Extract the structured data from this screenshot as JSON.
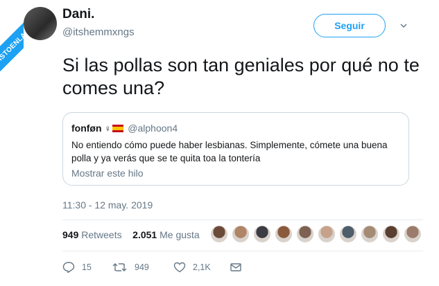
{
  "watermark": {
    "text": "VISTOENLASREDES.COM"
  },
  "author": {
    "name": "Dani.",
    "handle": "@itshemmxngs"
  },
  "follow_button": {
    "label": "Seguir"
  },
  "tweet": {
    "text": "Si las pollas son tan geniales por qué no te comes una?"
  },
  "quoted": {
    "name": "fonføn",
    "symbol": "♀",
    "handle": "@alphoon4",
    "text": "No entiendo cómo puede haber lesbianas. Simplemente, cómete una buena polla y ya verás que se te quita toa la tontería",
    "thread_link": "Mostrar este hilo"
  },
  "timestamp": "11:30 - 12 may. 2019",
  "stats": {
    "retweets_count": "949",
    "retweets_label": "Retweets",
    "likes_count": "2.051",
    "likes_label": "Me gusta"
  },
  "likers": [
    "#6b4a3a",
    "#b08466",
    "#3c3c44",
    "#8a5a3c",
    "#7d6152",
    "#c7a28a",
    "#4e5e6a",
    "#a38b74",
    "#5a3e32",
    "#9b7b6b"
  ],
  "actions": {
    "reply_count": "15",
    "retweet_count": "949",
    "like_count": "2,1K"
  },
  "colors": {
    "accent": "#1da1f2",
    "muted": "#657786",
    "border": "#ccd6dd"
  }
}
